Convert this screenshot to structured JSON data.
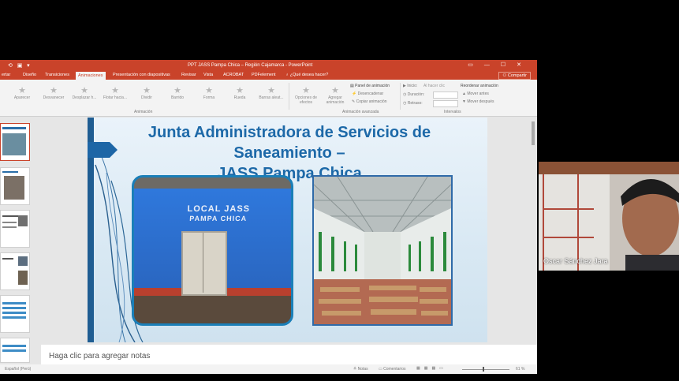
{
  "window": {
    "title": "PPT JASS Pampa Chica – Región Cajamarca - PowerPoint",
    "controls": [
      "▭",
      "—",
      "☐",
      "✕"
    ]
  },
  "tabs": [
    {
      "label": "ertar",
      "active": false
    },
    {
      "label": "Diseño",
      "active": false
    },
    {
      "label": "Transiciones",
      "active": false
    },
    {
      "label": "Animaciones",
      "active": true
    },
    {
      "label": "Presentación con diapositivas",
      "active": false
    },
    {
      "label": "Revisar",
      "active": false
    },
    {
      "label": "Vista",
      "active": false
    },
    {
      "label": "ACROBAT",
      "active": false
    },
    {
      "label": "PDFelement",
      "active": false
    },
    {
      "label": "¿Qué desea hacer?",
      "active": false
    }
  ],
  "share_label": "Compartir",
  "ribbon": {
    "effects": [
      "Aparecer",
      "Desvanecer",
      "Desplazar h...",
      "Flotar hacia...",
      "Dividir",
      "Barrido",
      "Forma",
      "Rueda",
      "Barras aleat..."
    ],
    "effect_options": "Opciones de efectos",
    "add_animation": "Agregar animación",
    "animation_pane": "Panel de animación",
    "trigger": "Desencadenar",
    "copy_animation": "Copiar animación",
    "start_label": "Inicio:",
    "start_value": "Al hacer clic",
    "duration_label": "Duración:",
    "delay_label": "Retraso:",
    "reorder": "Reordenar animación",
    "move_earlier": "Mover antes",
    "move_later": "Mover después",
    "group_animation": "Animación",
    "group_advanced": "Animación avanzada",
    "group_timing": "Intervalos"
  },
  "slide": {
    "title_line1": "Junta Administradora de Servicios de Saneamiento –",
    "title_line2": "JASS Pampa Chica",
    "photo1_sign_line1": "LOCAL JASS",
    "photo1_sign_line2": "PAMPA CHICA"
  },
  "notes_placeholder": "Haga clic para agregar notas",
  "status": {
    "language": "Español (Perú)",
    "notes": "Notas",
    "comments": "Comentarios",
    "zoom": "61 %"
  },
  "webcam": {
    "participant_name": "Oscar Sánchez Jara"
  },
  "colors": {
    "accent": "#c9432a",
    "slide_title": "#1d69a8"
  }
}
